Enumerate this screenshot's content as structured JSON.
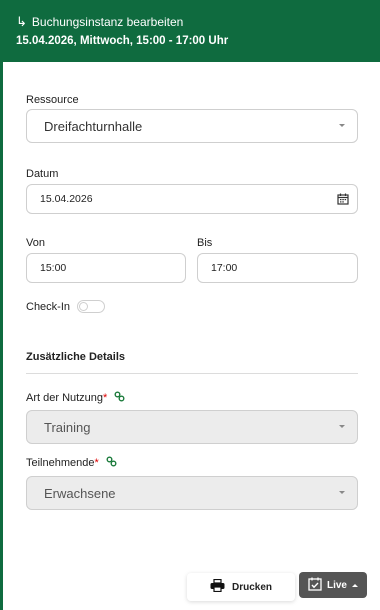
{
  "header": {
    "title": "Buchungsinstanz bearbeiten",
    "subtitle": "15.04.2026, Mittwoch,  15:00 - 17:00 Uhr",
    "color": "#0f6b3f"
  },
  "form": {
    "resource_label": "Ressource",
    "resource_value": "Dreifachturnhalle",
    "date_label": "Datum",
    "date_value": "15.04.2026",
    "from_label": "Von",
    "from_value": "15:00",
    "to_label": "Bis",
    "to_value": "17:00",
    "checkin_label": "Check-In",
    "checkin_on": false
  },
  "details": {
    "title": "Zusätzliche Details",
    "usage_label": "Art der Nutzung",
    "usage_value": "Training",
    "participants_label": "Teilnehmende",
    "participants_value": "Erwachsene",
    "required_mark": "*"
  },
  "footer": {
    "print_label": "Drucken",
    "live_label": "Live"
  },
  "icons": {
    "return": "return-arrow-icon",
    "calendar": "calendar-icon",
    "link": "link-icon",
    "print": "printer-icon",
    "calendar_check": "calendar-check-icon",
    "caret": "caret-up-icon"
  }
}
